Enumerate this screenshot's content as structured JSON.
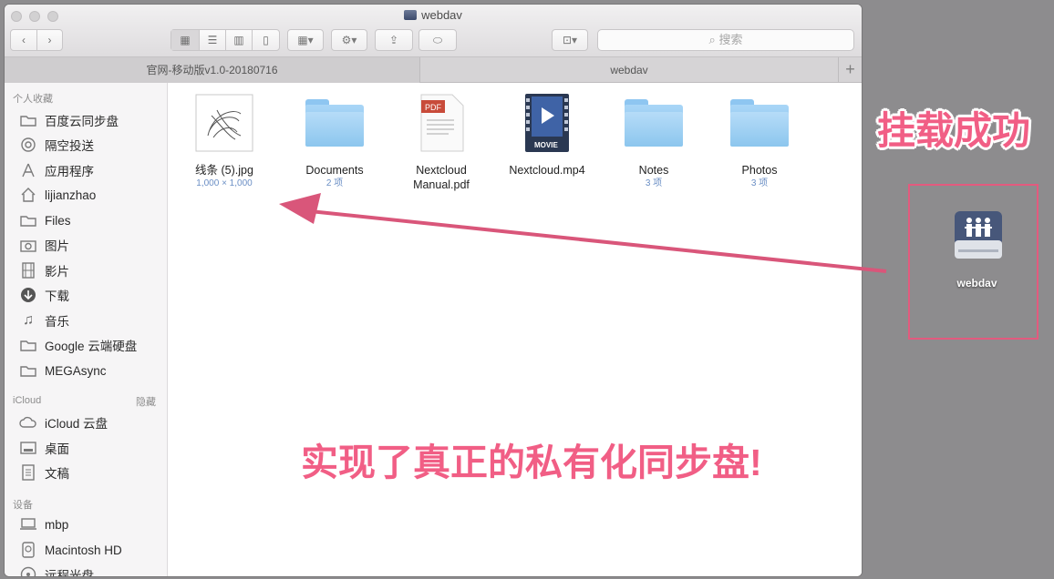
{
  "window": {
    "title": "webdav"
  },
  "toolbar": {
    "back_icon": "chevron-left-icon",
    "forward_icon": "chevron-right-icon",
    "view_icons": [
      "icon-view-icon",
      "list-view-icon",
      "column-view-icon",
      "cover-flow-icon"
    ],
    "search_placeholder": "搜索"
  },
  "tabs": [
    {
      "label": "官网-移动版v1.0-20180716",
      "active": false
    },
    {
      "label": "webdav",
      "active": true
    }
  ],
  "sidebar": {
    "favorites_header": "个人收藏",
    "favorites": [
      {
        "label": "百度云同步盘",
        "icon": "folder-icon"
      },
      {
        "label": "隔空投送",
        "icon": "airdrop-icon"
      },
      {
        "label": "应用程序",
        "icon": "applications-icon"
      },
      {
        "label": "lijianzhao",
        "icon": "home-icon"
      },
      {
        "label": "Files",
        "icon": "folder-icon"
      },
      {
        "label": "图片",
        "icon": "camera-icon"
      },
      {
        "label": "影片",
        "icon": "film-icon"
      },
      {
        "label": "下载",
        "icon": "download-icon"
      },
      {
        "label": "音乐",
        "icon": "music-icon"
      },
      {
        "label": "Google 云端硬盘",
        "icon": "folder-icon"
      },
      {
        "label": "MEGAsync",
        "icon": "folder-icon"
      }
    ],
    "icloud_header": "iCloud",
    "icloud_hide": "隐藏",
    "icloud": [
      {
        "label": "iCloud 云盘",
        "icon": "cloud-icon"
      },
      {
        "label": "桌面",
        "icon": "desktop-icon"
      },
      {
        "label": "文稿",
        "icon": "document-icon"
      }
    ],
    "devices_header": "设备",
    "devices": [
      {
        "label": "mbp",
        "icon": "laptop-icon"
      },
      {
        "label": "Macintosh HD",
        "icon": "hard-drive-icon"
      },
      {
        "label": "远程光盘",
        "icon": "disc-icon"
      }
    ]
  },
  "files": [
    {
      "name": "线条 (5).jpg",
      "sub": "1,000 × 1,000",
      "kind": "image"
    },
    {
      "name": "Documents",
      "sub": "2 项",
      "kind": "folder"
    },
    {
      "name": "Nextcloud Manual.pdf",
      "sub": "",
      "kind": "pdf",
      "badge": "PDF"
    },
    {
      "name": "Nextcloud.mp4",
      "sub": "",
      "kind": "movie",
      "badge": "MOVIE"
    },
    {
      "name": "Notes",
      "sub": "3 项",
      "kind": "folder"
    },
    {
      "name": "Photos",
      "sub": "3 项",
      "kind": "folder"
    }
  ],
  "annotations": {
    "top_right": "挂载成功",
    "bottom": "实现了真正的私有化同步盘!",
    "accent_color": "#f15e85"
  },
  "desktop": {
    "drive_label": "webdav",
    "icon": "network-drive-icon"
  }
}
